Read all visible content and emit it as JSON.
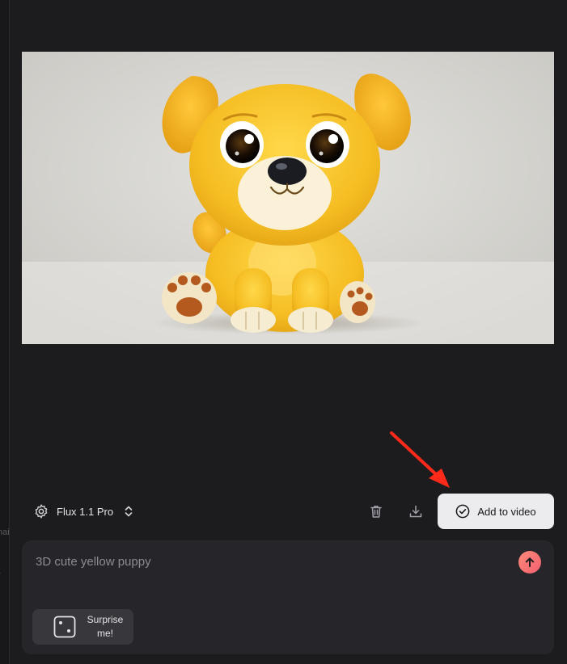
{
  "sidebar_edge": {
    "fragment_1": "hai",
    "fragment_2": "r"
  },
  "image": {
    "subject_icon": "puppy-illustration",
    "background_color": "#d9d8d4",
    "fur_color": "#f5c12e"
  },
  "toolbar": {
    "model_label": "Flux 1.1 Pro",
    "model_icon": "gear-icon",
    "model_chevron_icon": "chevron-up-down-icon",
    "delete_icon": "trash-icon",
    "download_icon": "download-icon",
    "add_button_label": "Add to video",
    "add_button_icon": "check-circle-icon"
  },
  "prompt": {
    "text": "3D cute yellow puppy",
    "send_icon": "arrow-up-icon",
    "send_color": "#f46a72",
    "surprise_label": "Surprise me!",
    "surprise_icon": "dice-icon"
  },
  "annotation": {
    "arrow_color": "#ff2a1a"
  }
}
